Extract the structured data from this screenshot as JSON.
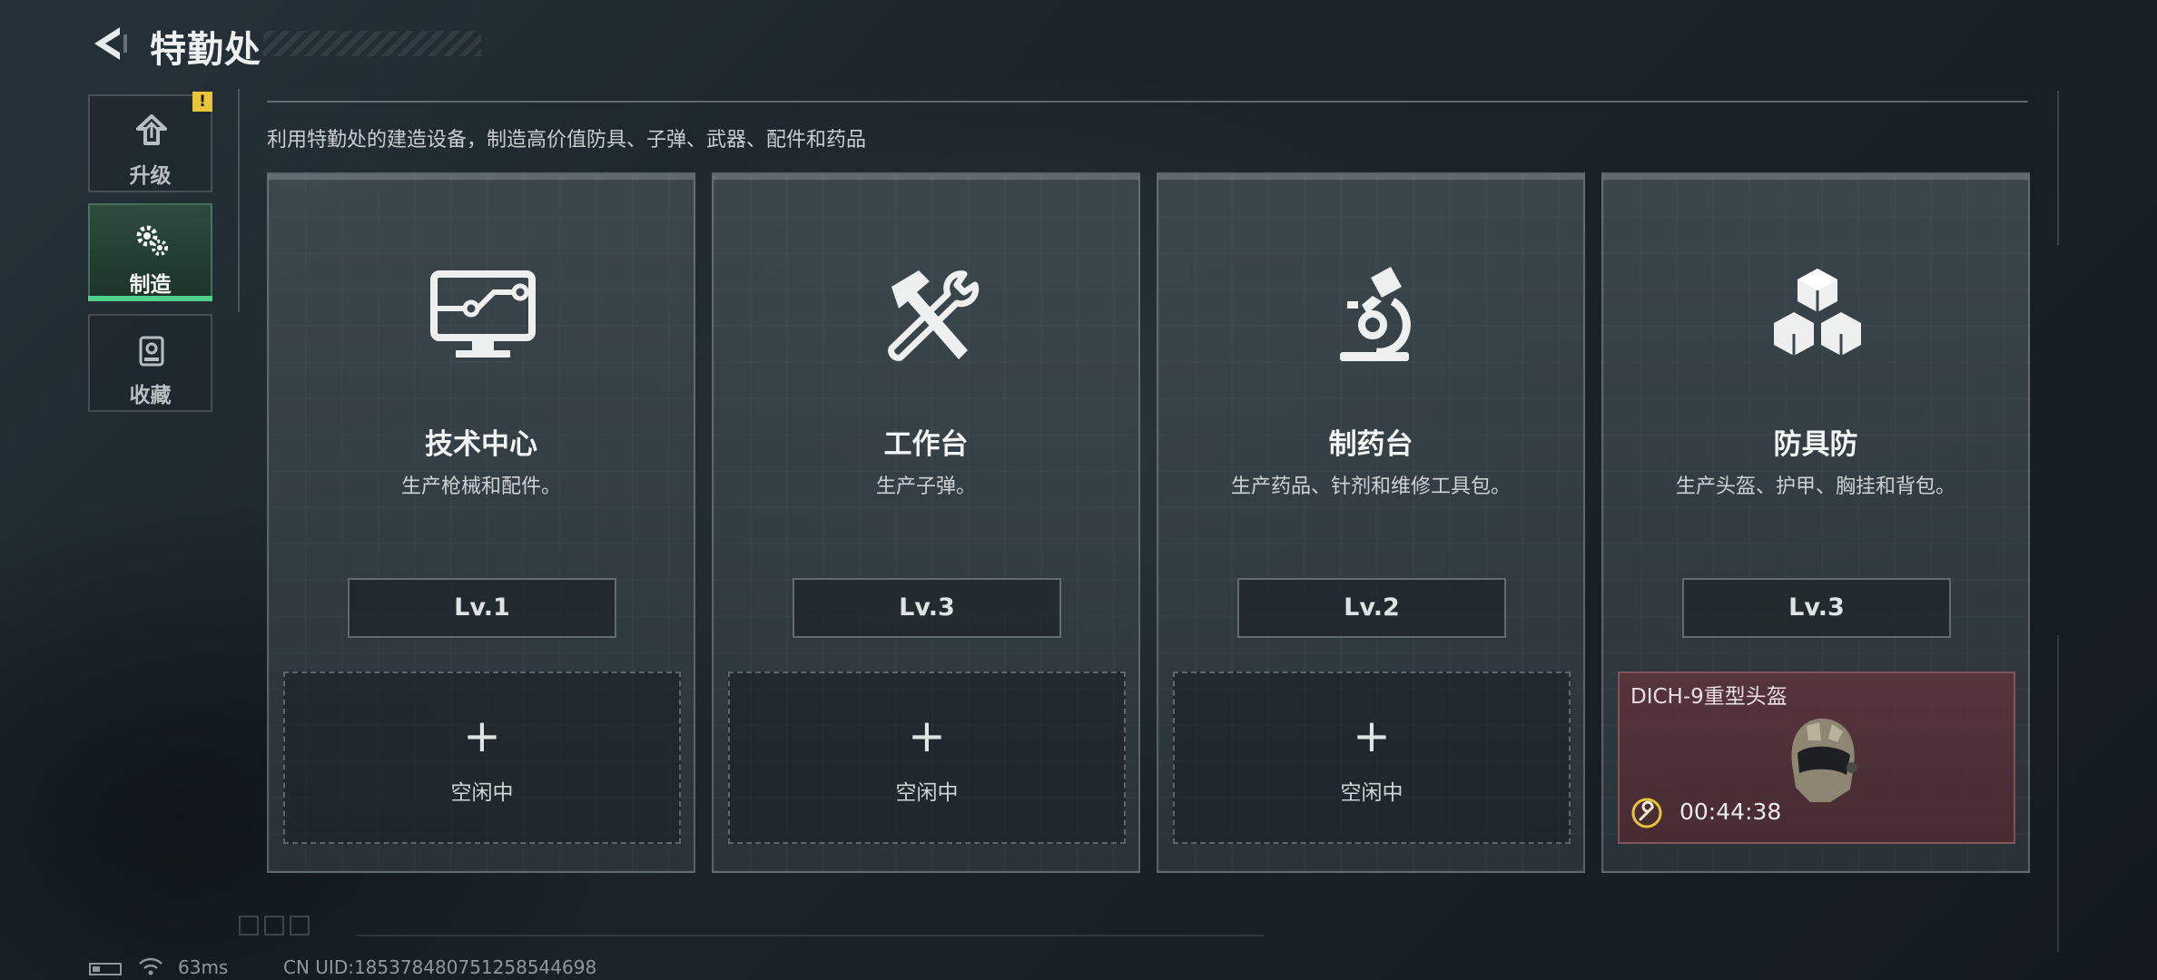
{
  "header": {
    "title": "特勤处"
  },
  "nav": {
    "items": [
      {
        "label": "升级",
        "icon": "upgrade-icon",
        "active": false,
        "alert": "!"
      },
      {
        "label": "制造",
        "icon": "gears-icon",
        "active": true
      },
      {
        "label": "收藏",
        "icon": "collection-icon",
        "active": false
      }
    ]
  },
  "description": "利用特勤处的建造设备，制造高价值防具、子弹、武器、配件和药品",
  "cards": [
    {
      "name": "技术中心",
      "desc": "生产枪械和配件。",
      "level": "Lv.1",
      "icon": "monitor-circuit-icon",
      "slot": {
        "plus": "+",
        "status": "空闲中"
      }
    },
    {
      "name": "工作台",
      "desc": "生产子弹。",
      "level": "Lv.3",
      "icon": "hammer-wrench-icon",
      "slot": {
        "plus": "+",
        "status": "空闲中"
      }
    },
    {
      "name": "制药台",
      "desc": "生产药品、针剂和维修工具包。",
      "level": "Lv.2",
      "icon": "microscope-icon",
      "slot": {
        "plus": "+",
        "status": "空闲中"
      }
    },
    {
      "name": "防具防",
      "desc": "生产头盔、护甲、胸挂和背包。",
      "level": "Lv.3",
      "icon": "cubes-icon",
      "slot": {
        "item": "DICH-9重型头盔",
        "timer": "00:44:38",
        "icon": "helmet-icon"
      }
    }
  ],
  "status": {
    "ping": "63ms",
    "uid": "CN UID:185378480751258544698"
  },
  "colors": {
    "accent_green": "#4fd18a",
    "alert_yellow": "#e7c43a",
    "busy_slot": "#5c343a",
    "timer_ring": "#e7c43a"
  }
}
